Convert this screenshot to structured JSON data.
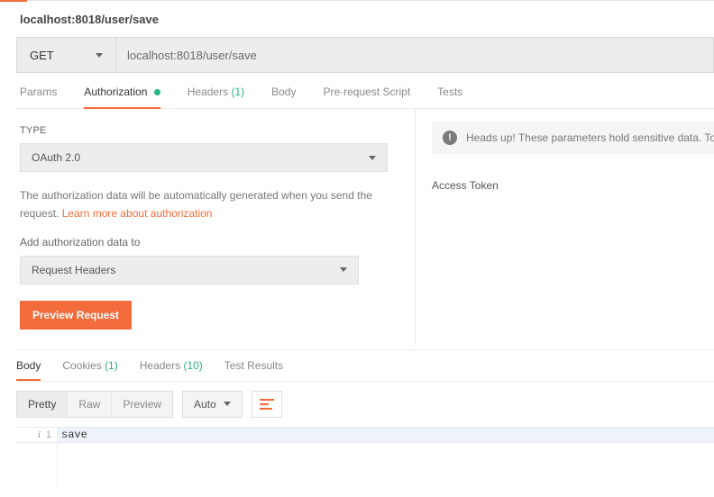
{
  "header": {
    "tab_title": "localhost:8018/user/save"
  },
  "request": {
    "method": "GET",
    "url": "localhost:8018/user/save"
  },
  "req_tabs": {
    "params": "Params",
    "authorization": "Authorization",
    "headers": "Headers",
    "headers_count": "(1)",
    "body": "Body",
    "prereq": "Pre-request Script",
    "tests": "Tests"
  },
  "auth_panel": {
    "type_label": "TYPE",
    "type_value": "OAuth 2.0",
    "helper_text": "The authorization data will be automatically generated when you send the request. ",
    "learn_more": "Learn more about authorization",
    "add_to_label": "Add authorization data to",
    "add_to_value": "Request Headers",
    "preview_btn": "Preview Request"
  },
  "right_panel": {
    "notice_text": "Heads up! These parameters hold sensitive data. To",
    "access_token_label": "Access Token"
  },
  "resp_tabs": {
    "body": "Body",
    "cookies": "Cookies",
    "cookies_count": "(1)",
    "headers": "Headers",
    "headers_count": "(10)",
    "test_results": "Test Results"
  },
  "viewer": {
    "pretty": "Pretty",
    "raw": "Raw",
    "preview": "Preview",
    "auto": "Auto"
  },
  "response_body": {
    "line_no": "1",
    "content": "save"
  }
}
